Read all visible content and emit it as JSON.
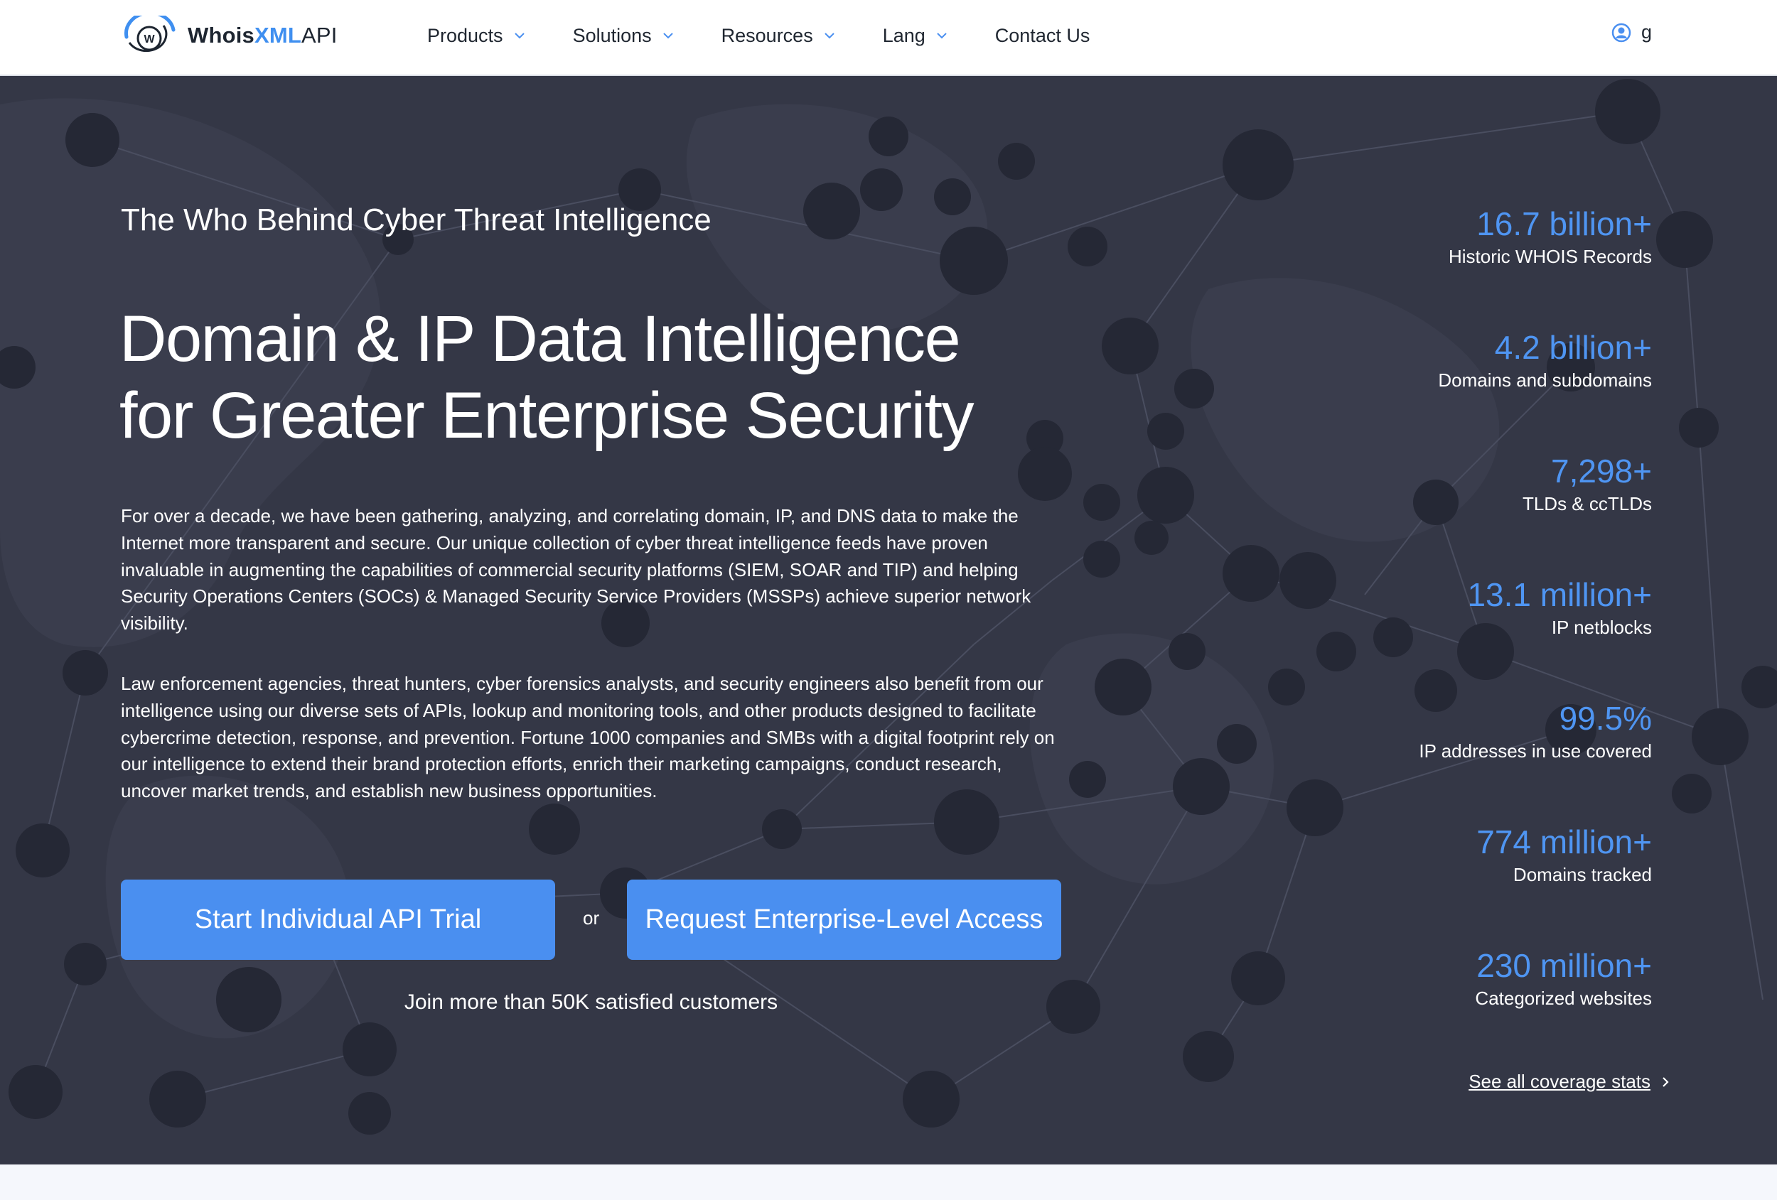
{
  "nav": {
    "logo": {
      "part1": "Whois",
      "part2": "XML",
      "part3": "API",
      "icon": "whoisxml-logo-icon"
    },
    "items": [
      {
        "label": "Products",
        "has_dropdown": true
      },
      {
        "label": "Solutions",
        "has_dropdown": true
      },
      {
        "label": "Resources",
        "has_dropdown": true
      },
      {
        "label": "Lang",
        "has_dropdown": true
      },
      {
        "label": "Contact Us",
        "has_dropdown": false
      }
    ],
    "user": {
      "icon": "user-icon",
      "label": "g"
    }
  },
  "hero": {
    "kicker": "The Who Behind Cyber Threat Intelligence",
    "headline_line1": "Domain & IP Data Intelligence",
    "headline_line2": "for Greater Enterprise Security",
    "paragraph1": "For over a decade, we have been gathering, analyzing, and correlating domain, IP, and DNS data to make the Internet more transparent and secure. Our unique collection of cyber threat intelligence feeds have proven invaluable in augmenting the capabilities of commercial security platforms (SIEM, SOAR and TIP) and helping Security Operations Centers (SOCs) & Managed Security Service Providers (MSSPs) achieve superior network visibility.",
    "paragraph2": "Law enforcement agencies, threat hunters, cyber forensics analysts, and security engineers also benefit from our intelligence using our diverse sets of APIs, lookup and monitoring tools, and other products designed to facilitate cybercrime detection, response, and prevention. Fortune 1000 companies and SMBs with a digital footprint rely on our intelligence to extend their brand protection efforts, enrich their marketing campaigns, conduct research, uncover market trends, and establish new business opportunities.",
    "cta_primary": "Start Individual API Trial",
    "or_text": "or",
    "cta_secondary": "Request Enterprise-Level Access",
    "join_text": "Join more than 50K satisfied customers"
  },
  "stats": [
    {
      "value": "16.7 billion+",
      "label": "Historic WHOIS Records"
    },
    {
      "value": "4.2 billion+",
      "label": "Domains and subdomains"
    },
    {
      "value": "7,298+",
      "label": "TLDs & ccTLDs"
    },
    {
      "value": "13.1 million+",
      "label": "IP netblocks"
    },
    {
      "value": "99.5%",
      "label": "IP addresses in use covered"
    },
    {
      "value": "774 million+",
      "label": "Domains tracked"
    },
    {
      "value": "230 million+",
      "label": "Categorized websites"
    }
  ],
  "see_all": {
    "label": "See all coverage stats",
    "icon": "chevron-right-icon"
  },
  "colors": {
    "accent": "#4a8ff0",
    "stat_number": "#4f95f2",
    "hero_bg": "#343746",
    "nav_bg": "#ffffff"
  }
}
